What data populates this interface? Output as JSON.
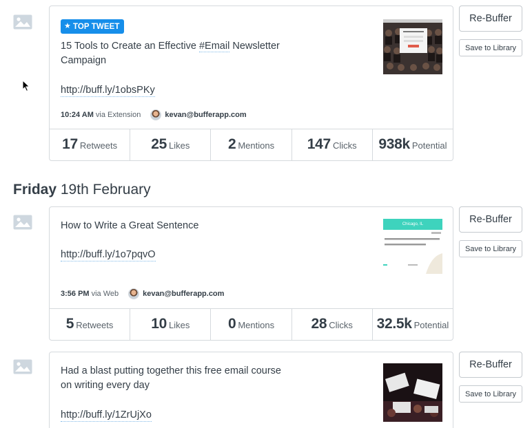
{
  "posts": [
    {
      "badge": "TOP TWEET",
      "text_before": "15 Tools to Create an Effective ",
      "hashtag": "#Email",
      "text_after": " Newsletter Campaign",
      "link": "http://buff.ly/1obsPKy",
      "time": "10:24 AM",
      "via": "via Extension",
      "author": "kevan@bufferapp.com",
      "stats": [
        {
          "value": "17",
          "label": "Retweets"
        },
        {
          "value": "25",
          "label": "Likes"
        },
        {
          "value": "2",
          "label": "Mentions"
        },
        {
          "value": "147",
          "label": "Clicks"
        },
        {
          "value": "938k",
          "label": "Potential"
        }
      ],
      "rebuffer_label": "Re-Buffer",
      "library_label": "Save to Library",
      "thumb_icon": "webpage-screenshot-thumbnail"
    },
    {
      "text": "How to Write a Great Sentence",
      "link": "http://buff.ly/1o7pqvO",
      "time": "3:56 PM",
      "via": "via Web",
      "author": "kevan@bufferapp.com",
      "thumb_header": "Chicago, IL",
      "stats": [
        {
          "value": "5",
          "label": "Retweets"
        },
        {
          "value": "10",
          "label": "Likes"
        },
        {
          "value": "0",
          "label": "Mentions"
        },
        {
          "value": "28",
          "label": "Clicks"
        },
        {
          "value": "32.5k",
          "label": "Potential"
        }
      ],
      "rebuffer_label": "Re-Buffer",
      "library_label": "Save to Library"
    },
    {
      "text": "Had a blast putting together this free email course on writing every day",
      "link": "http://buff.ly/1ZrUjXo",
      "rebuffer_label": "Re-Buffer",
      "library_label": "Save to Library",
      "thumb_icon": "crowd-photo-thumbnail"
    }
  ],
  "day_header": {
    "day": "Friday",
    "date": "19th February"
  },
  "icons": {
    "post_type": "image-icon",
    "cursor": "mouse-cursor-icon"
  },
  "colors": {
    "accent": "#168eea",
    "border": "#d5d9dd",
    "text": "#343e47"
  }
}
